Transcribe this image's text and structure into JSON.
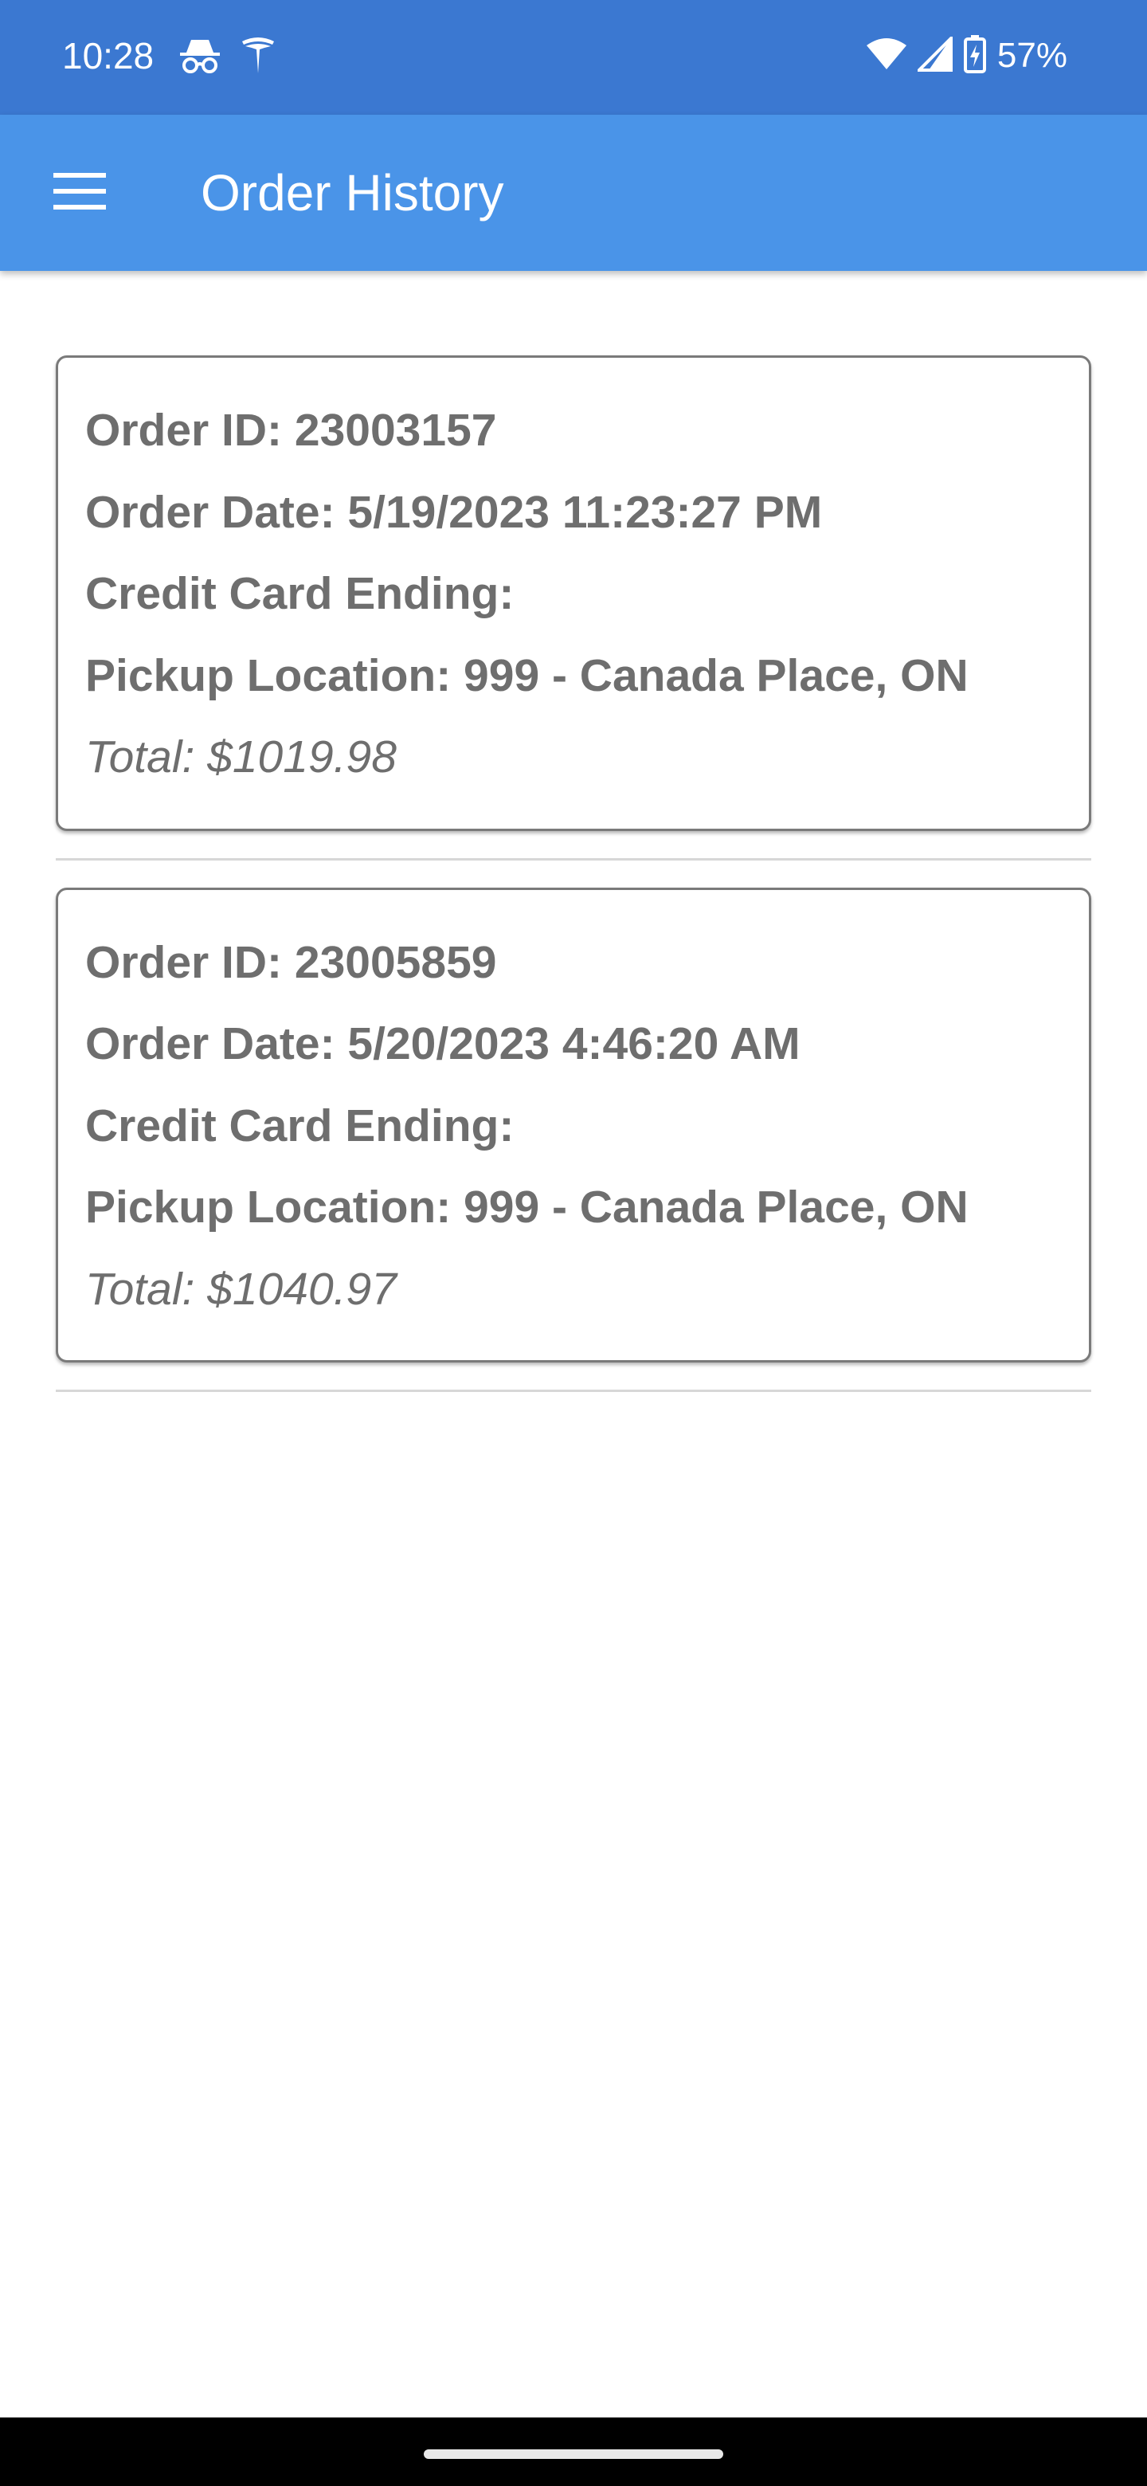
{
  "status_bar": {
    "time": "10:28",
    "left_icons": [
      "incognito-icon",
      "tesla-icon"
    ],
    "right_icons": [
      "wifi-icon",
      "cell-signal-icon",
      "battery-charging-icon"
    ],
    "battery": "57%"
  },
  "app_bar": {
    "title": "Order History",
    "menu_icon": "hamburger-menu-icon",
    "background": "#4a94e8"
  },
  "orders": [
    {
      "order_id": "Order ID: 23003157",
      "order_date": "Order Date: 5/19/2023 11:23:27 PM",
      "credit_card": "Credit Card Ending:",
      "pickup_location": "Pickup Location: 999 - Canada Place, ON",
      "total": "Total: $1019.98"
    },
    {
      "order_id": "Order ID: 23005859",
      "order_date": "Order Date: 5/20/2023 4:46:20 AM",
      "credit_card": "Credit Card Ending:",
      "pickup_location": "Pickup Location: 999 - Canada Place, ON",
      "total": "Total: $1040.97"
    }
  ],
  "colors": {
    "status_bar": "#3b78d1",
    "app_bar": "#4a94e8",
    "text": "#6e6e6e"
  }
}
